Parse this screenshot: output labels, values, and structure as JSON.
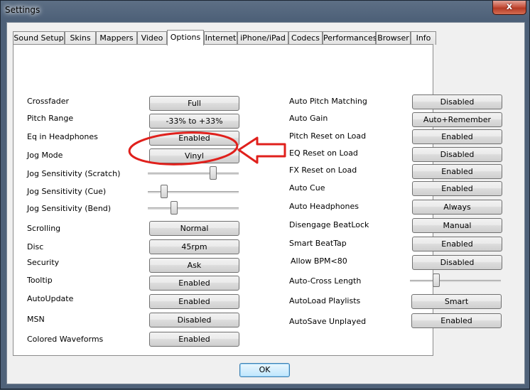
{
  "window": {
    "title": "Settings",
    "close_glyph": "x"
  },
  "tabs": [
    "Sound Setup",
    "Skins",
    "Mappers",
    "Video",
    "Options",
    "Internet",
    "iPhone/iPad",
    "Codecs",
    "Performances",
    "Browser",
    "Info"
  ],
  "active_tab": "Options",
  "left": {
    "crossfader": {
      "label": "Crossfader",
      "value": "Full"
    },
    "pitch_range": {
      "label": "Pitch Range",
      "value": "-33% to +33%"
    },
    "eq_headphones": {
      "label": "Eq in Headphones",
      "value": "Enabled"
    },
    "jog_mode": {
      "label": "Jog Mode",
      "value": "Vinyl"
    },
    "jog_scratch": {
      "label": "Jog Sensitivity (Scratch)",
      "level": 0.74
    },
    "jog_cue": {
      "label": "Jog Sensitivity (Cue)",
      "level": 0.15
    },
    "jog_bend": {
      "label": "Jog Sensitivity (Bend)",
      "level": 0.27
    },
    "scrolling": {
      "label": "Scrolling",
      "value": "Normal"
    },
    "disc": {
      "label": "Disc",
      "value": "45rpm"
    },
    "security": {
      "label": "Security",
      "value": "Ask"
    },
    "tooltip": {
      "label": "Tooltip",
      "value": "Enabled"
    },
    "autoupdate": {
      "label": "AutoUpdate",
      "value": "Enabled"
    },
    "msn": {
      "label": "MSN",
      "value": "Disabled"
    },
    "colored_waveforms": {
      "label": "Colored Waveforms",
      "value": "Enabled"
    }
  },
  "right": {
    "auto_pitch": {
      "label": "Auto Pitch Matching",
      "value": "Disabled"
    },
    "auto_gain": {
      "label": "Auto Gain",
      "value": "Auto+Remember"
    },
    "pitch_reset": {
      "label": "Pitch Reset on Load",
      "value": "Enabled"
    },
    "eq_reset": {
      "label": "EQ Reset on Load",
      "value": "Disabled"
    },
    "fx_reset": {
      "label": "FX Reset on Load",
      "value": "Enabled"
    },
    "auto_cue": {
      "label": "Auto Cue",
      "value": "Enabled"
    },
    "auto_headphones": {
      "label": "Auto Headphones",
      "value": "Always"
    },
    "disengage": {
      "label": "Disengage BeatLock",
      "value": "Manual"
    },
    "smart_beattap": {
      "label": "Smart BeatTap",
      "value": "Enabled"
    },
    "allow_bpm": {
      "label": "Allow BPM<80",
      "value": "Disabled"
    },
    "autocross": {
      "label": "Auto-Cross Length",
      "level": 0.27
    },
    "autoload": {
      "label": "AutoLoad Playlists",
      "value": "Smart"
    },
    "autosave": {
      "label": "AutoSave Unplayed",
      "value": "Enabled"
    }
  },
  "ok_label": "OK",
  "annotation_color": "#e0201c"
}
